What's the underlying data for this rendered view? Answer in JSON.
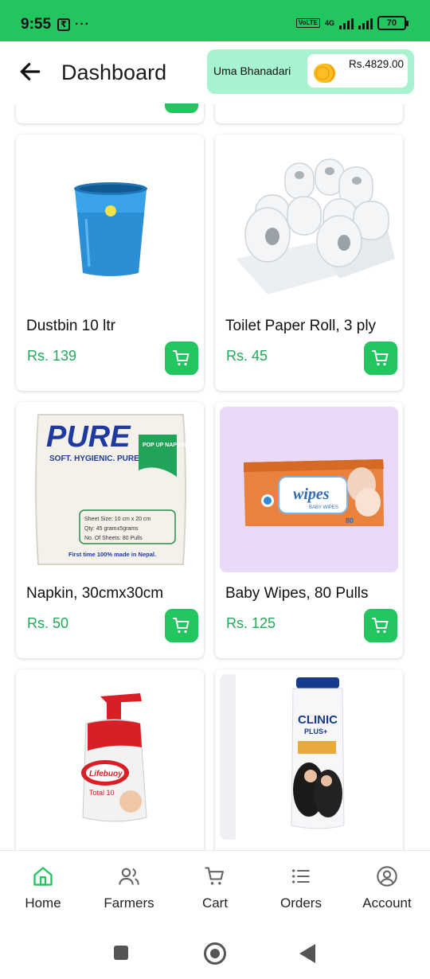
{
  "status_bar": {
    "time": "9:55",
    "currency_icon": "rupee-icon",
    "more_dots": "···",
    "volte": "VoLTE",
    "network": "4G",
    "battery": "70"
  },
  "header": {
    "back_icon": "arrow-left-icon",
    "title": "Dashboard",
    "user_name": "Uma Bhanadari",
    "coin_icon": "coin-stack-icon",
    "wallet_balance": "Rs.4829.00"
  },
  "products": [
    {
      "name": "Dustbin 10 ltr",
      "price": "Rs. 139",
      "image": "blue-dustbin"
    },
    {
      "name": "Toilet Paper Roll, 3 ply",
      "price": "Rs. 45",
      "image": "toilet-paper-rolls"
    },
    {
      "name": "Napkin, 30cmx30cm",
      "price": "Rs. 50",
      "image": "pure-napkin-pack"
    },
    {
      "name": "Baby Wipes, 80 Pulls",
      "price": "Rs. 125",
      "image": "baby-wipes-pack"
    },
    {
      "name": "",
      "price": "",
      "image": "lifebuoy-handwash"
    },
    {
      "name": "",
      "price": "",
      "image": "clinic-plus-shampoo"
    }
  ],
  "product_art": {
    "pure_brand": "PURE",
    "pure_tagline": "SOFT. HYGIENIC. PURE.",
    "pure_badge": "POP UP NAPKINS",
    "pure_spec_1": "Sheet Size: 10 cm x 20 cm",
    "pure_spec_2": "Qty: 45 gram±5grams",
    "pure_spec_3": "No. Of Sheets: 80 Pulls",
    "pure_footer": "First time 100% made in Nepal.",
    "wipes_brand": "wipes",
    "wipes_label": "BABY WIPES",
    "wipes_count": "80",
    "lifebuoy_brand": "Lifebuoy",
    "lifebuoy_variant": "Total 10",
    "clinic_brand": "CLINIC",
    "clinic_sub": "PLUS+"
  },
  "bottom_nav": [
    {
      "label": "Home",
      "icon": "home-icon",
      "active": true
    },
    {
      "label": "Farmers",
      "icon": "users-icon",
      "active": false
    },
    {
      "label": "Cart",
      "icon": "cart-icon",
      "active": false
    },
    {
      "label": "Orders",
      "icon": "list-icon",
      "active": false
    },
    {
      "label": "Account",
      "icon": "account-circle-icon",
      "active": false
    }
  ],
  "colors": {
    "accent": "#22c55e",
    "price": "#22a85a",
    "user_chip": "#a7f3d0"
  }
}
